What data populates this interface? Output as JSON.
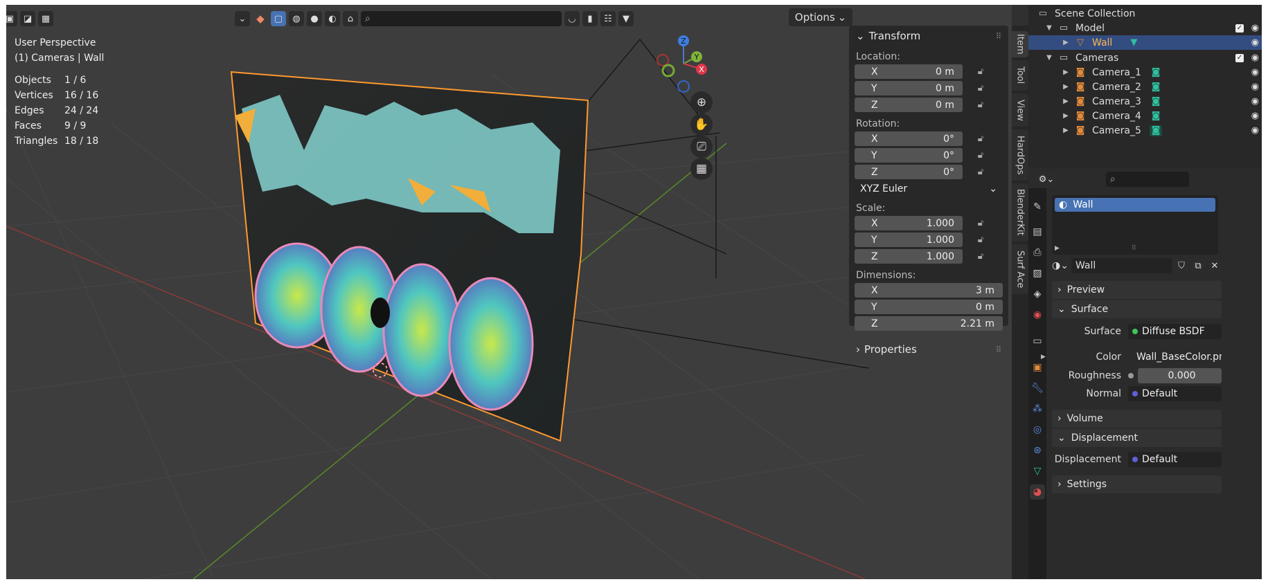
{
  "viewport": {
    "header": {
      "options_label": "Options",
      "search_placeholder": ""
    },
    "overlay": {
      "perspective": "User Perspective",
      "context": "(1) Cameras | Wall",
      "stats": [
        {
          "key": "Objects",
          "value": "1 / 6"
        },
        {
          "key": "Vertices",
          "value": "16 / 16"
        },
        {
          "key": "Edges",
          "value": "24 / 24"
        },
        {
          "key": "Faces",
          "value": "9 / 9"
        },
        {
          "key": "Triangles",
          "value": "18 / 18"
        }
      ]
    },
    "gizmo": {
      "x": "X",
      "y": "Y",
      "z": "Z"
    }
  },
  "npanel": {
    "title": "Transform",
    "location_label": "Location:",
    "location": {
      "x": "0 m",
      "y": "0 m",
      "z": "0 m"
    },
    "rotation_label": "Rotation:",
    "rotation": {
      "x": "0°",
      "y": "0°",
      "z": "0°"
    },
    "rotation_mode": "XYZ Euler",
    "scale_label": "Scale:",
    "scale": {
      "x": "1.000",
      "y": "1.000",
      "z": "1.000"
    },
    "dimensions_label": "Dimensions:",
    "dimensions": {
      "x": "3 m",
      "y": "0 m",
      "z": "2.21 m"
    },
    "axis": {
      "x": "X",
      "y": "Y",
      "z": "Z"
    },
    "properties_label": "Properties",
    "tabs": [
      "Item",
      "Tool",
      "View",
      "HardOps",
      "BlenderKit",
      "Surf Ace"
    ]
  },
  "outliner": {
    "root": "Scene Collection",
    "model": "Model",
    "wall": "Wall",
    "cameras_collection": "Cameras",
    "cameras": [
      "Camera_1",
      "Camera_2",
      "Camera_3",
      "Camera_4",
      "Camera_5"
    ]
  },
  "properties": {
    "material_slot": "Wall",
    "material_name": "Wall",
    "preview": "Preview",
    "surface_section": "Surface",
    "surface_label": "Surface",
    "surface_value": "Diffuse BSDF",
    "color_label": "Color",
    "color_value": "Wall_BaseColor.png",
    "roughness_label": "Roughness",
    "roughness_value": "0.000",
    "normal_label": "Normal",
    "normal_value": "Default",
    "volume": "Volume",
    "displacement_section": "Displacement",
    "displacement_label": "Displacement",
    "displacement_value": "Default",
    "settings": "Settings"
  },
  "colors": {
    "accent": "#4772b3",
    "selection": "#ff9a2e",
    "camera_icon": "#2fbf9e",
    "wall_icon": "#e08a3a"
  }
}
